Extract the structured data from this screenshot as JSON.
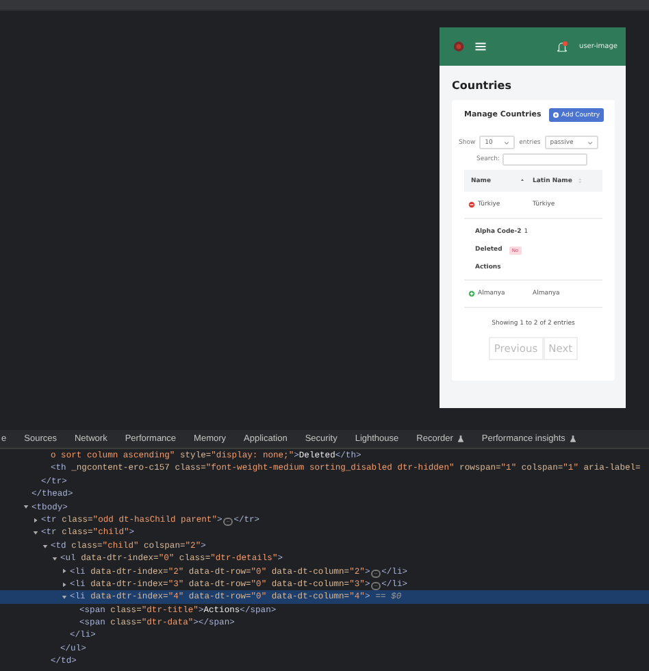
{
  "app_preview": {
    "header": {
      "user_image_alt": "user-image"
    },
    "page_title": "Countries",
    "card": {
      "title": "Manage Countries",
      "add_button": "Add Country",
      "length": {
        "show": "Show",
        "value": "10",
        "entries": "entries"
      },
      "status_filter": "passive",
      "search_label": "Search:",
      "columns": [
        {
          "label": "Name",
          "sorted_ascending": true
        },
        {
          "label": "Latin Name",
          "sorted_ascending": false
        }
      ],
      "rows": [
        {
          "name": "Türkiye",
          "latin_name": "Türkiye",
          "expanded": true,
          "details": [
            {
              "kind": "text",
              "label": "Alpha Code-2",
              "value": "1"
            },
            {
              "kind": "badge",
              "label": "Deleted",
              "value": "No"
            },
            {
              "kind": "text",
              "label": "Actions"
            }
          ]
        },
        {
          "name": "Almanya",
          "latin_name": "Almanya",
          "expanded": false
        }
      ],
      "info": "Showing 1 to 2 of 2 entries",
      "pagination": [
        {
          "label": "Previous",
          "disabled": true
        },
        {
          "label": "Next",
          "disabled": true
        }
      ]
    }
  },
  "devtools": {
    "tabs": [
      {
        "label": "e",
        "experimental": false
      },
      {
        "label": "Sources",
        "experimental": false
      },
      {
        "label": "Network",
        "experimental": false
      },
      {
        "label": "Performance",
        "experimental": false
      },
      {
        "label": "Memory",
        "experimental": false
      },
      {
        "label": "Application",
        "experimental": false
      },
      {
        "label": "Security",
        "experimental": false
      },
      {
        "label": "Lighthouse",
        "experimental": false
      },
      {
        "label": "Recorder",
        "experimental": true
      },
      {
        "label": "Performance insights",
        "experimental": true
      }
    ],
    "tree": [
      {
        "closing": [
          {
            "kind": "tag",
            "text": "</thead>"
          }
        ],
        "children": [
          {
            "closing": [
              {
                "kind": "tag",
                "text": "</tr>"
              }
            ],
            "children": [
              {
                "selected": false,
                "tokens": [
                  {
                    "kind": "value",
                    "text": "o sort column ascending\""
                  },
                  {
                    "kind": "attr",
                    "text": " style="
                  },
                  {
                    "kind": "value",
                    "text": "\"display: none;\""
                  },
                  {
                    "kind": "tag",
                    "text": ">"
                  },
                  {
                    "kind": "text",
                    "text": "Deleted"
                  },
                  {
                    "kind": "tag",
                    "text": "</th>"
                  }
                ]
              },
              {
                "selected": false,
                "tokens": [
                  {
                    "kind": "tag",
                    "text": "<th"
                  },
                  {
                    "kind": "attr",
                    "text": " _ngcontent-ero-c157 class="
                  },
                  {
                    "kind": "value",
                    "text": "\"font-weight-medium sorting_disabled dtr-hidden\""
                  },
                  {
                    "kind": "attr",
                    "text": " rowspan="
                  },
                  {
                    "kind": "value",
                    "text": "\"1\""
                  },
                  {
                    "kind": "attr",
                    "text": " colspan="
                  },
                  {
                    "kind": "value",
                    "text": "\"1\""
                  },
                  {
                    "kind": "attr",
                    "text": " aria-label="
                  }
                ]
              }
            ]
          }
        ]
      },
      {
        "selected": false,
        "expanded": true,
        "tokens": [
          {
            "kind": "tag",
            "text": "<tbody>"
          }
        ],
        "children": [
          {
            "selected": false,
            "expanded": false,
            "tokens": [
              {
                "kind": "tag",
                "text": "<tr"
              },
              {
                "kind": "attr",
                "text": " class="
              },
              {
                "kind": "value",
                "text": "\"odd dt-hasChild parent\""
              },
              {
                "kind": "tag",
                "text": ">"
              },
              {
                "kind": "ellipsis",
                "text": "…"
              },
              {
                "kind": "tag",
                "text": "</tr>"
              }
            ]
          },
          {
            "selected": false,
            "expanded": true,
            "tokens": [
              {
                "kind": "tag",
                "text": "<tr"
              },
              {
                "kind": "attr",
                "text": " class="
              },
              {
                "kind": "value",
                "text": "\"child\""
              },
              {
                "kind": "tag",
                "text": ">"
              }
            ],
            "children": [
              {
                "selected": false,
                "expanded": true,
                "tokens": [
                  {
                    "kind": "tag",
                    "text": "<td"
                  },
                  {
                    "kind": "attr",
                    "text": " class="
                  },
                  {
                    "kind": "value",
                    "text": "\"child\""
                  },
                  {
                    "kind": "attr",
                    "text": " colspan="
                  },
                  {
                    "kind": "value",
                    "text": "\"2\""
                  },
                  {
                    "kind": "tag",
                    "text": ">"
                  }
                ],
                "closing": [
                  {
                    "kind": "tag",
                    "text": "</td>"
                  }
                ],
                "children": [
                  {
                    "selected": false,
                    "expanded": true,
                    "tokens": [
                      {
                        "kind": "tag",
                        "text": "<ul"
                      },
                      {
                        "kind": "attr",
                        "text": " data-dtr-index="
                      },
                      {
                        "kind": "value",
                        "text": "\"0\""
                      },
                      {
                        "kind": "attr",
                        "text": " class="
                      },
                      {
                        "kind": "value",
                        "text": "\"dtr-details\""
                      },
                      {
                        "kind": "tag",
                        "text": ">"
                      }
                    ],
                    "closing": [
                      {
                        "kind": "tag",
                        "text": "</ul>"
                      }
                    ],
                    "children": [
                      {
                        "selected": false,
                        "expanded": false,
                        "tokens": [
                          {
                            "kind": "tag",
                            "text": "<li"
                          },
                          {
                            "kind": "attr",
                            "text": " data-dtr-index="
                          },
                          {
                            "kind": "value",
                            "text": "\"2\""
                          },
                          {
                            "kind": "attr",
                            "text": " data-dt-row="
                          },
                          {
                            "kind": "value",
                            "text": "\"0\""
                          },
                          {
                            "kind": "attr",
                            "text": " data-dt-column="
                          },
                          {
                            "kind": "value",
                            "text": "\"2\""
                          },
                          {
                            "kind": "tag",
                            "text": ">"
                          },
                          {
                            "kind": "ellipsis",
                            "text": "…"
                          },
                          {
                            "kind": "tag",
                            "text": "</li>"
                          }
                        ]
                      },
                      {
                        "selected": false,
                        "expanded": false,
                        "tokens": [
                          {
                            "kind": "tag",
                            "text": "<li"
                          },
                          {
                            "kind": "attr",
                            "text": " data-dtr-index="
                          },
                          {
                            "kind": "value",
                            "text": "\"3\""
                          },
                          {
                            "kind": "attr",
                            "text": " data-dt-row="
                          },
                          {
                            "kind": "value",
                            "text": "\"0\""
                          },
                          {
                            "kind": "attr",
                            "text": " data-dt-column="
                          },
                          {
                            "kind": "value",
                            "text": "\"3\""
                          },
                          {
                            "kind": "tag",
                            "text": ">"
                          },
                          {
                            "kind": "ellipsis",
                            "text": "…"
                          },
                          {
                            "kind": "tag",
                            "text": "</li>"
                          }
                        ]
                      },
                      {
                        "selected": true,
                        "expanded": true,
                        "tokens": [
                          {
                            "kind": "tag",
                            "text": "<li"
                          },
                          {
                            "kind": "attr",
                            "text": " data-dtr-index="
                          },
                          {
                            "kind": "value",
                            "text": "\"4\""
                          },
                          {
                            "kind": "attr",
                            "text": " data-dt-row="
                          },
                          {
                            "kind": "value",
                            "text": "\"0\""
                          },
                          {
                            "kind": "attr",
                            "text": " data-dt-column="
                          },
                          {
                            "kind": "value",
                            "text": "\"4\""
                          },
                          {
                            "kind": "tag",
                            "text": ">"
                          },
                          {
                            "kind": "marker",
                            "text": "== $0"
                          }
                        ],
                        "closing": [
                          {
                            "kind": "tag",
                            "text": "</li>"
                          }
                        ],
                        "children": [
                          {
                            "selected": false,
                            "tokens": [
                              {
                                "kind": "tag",
                                "text": "<span"
                              },
                              {
                                "kind": "attr",
                                "text": " class="
                              },
                              {
                                "kind": "value",
                                "text": "\"dtr-title\""
                              },
                              {
                                "kind": "tag",
                                "text": ">"
                              },
                              {
                                "kind": "text",
                                "text": "Actions"
                              },
                              {
                                "kind": "tag",
                                "text": "</span>"
                              }
                            ]
                          },
                          {
                            "selected": false,
                            "tokens": [
                              {
                                "kind": "tag",
                                "text": "<span"
                              },
                              {
                                "kind": "attr",
                                "text": " class="
                              },
                              {
                                "kind": "value",
                                "text": "\"dtr-data\""
                              },
                              {
                                "kind": "tag",
                                "text": "></span>"
                              }
                            ]
                          }
                        ]
                      }
                    ]
                  }
                ]
              }
            ]
          }
        ]
      }
    ]
  }
}
